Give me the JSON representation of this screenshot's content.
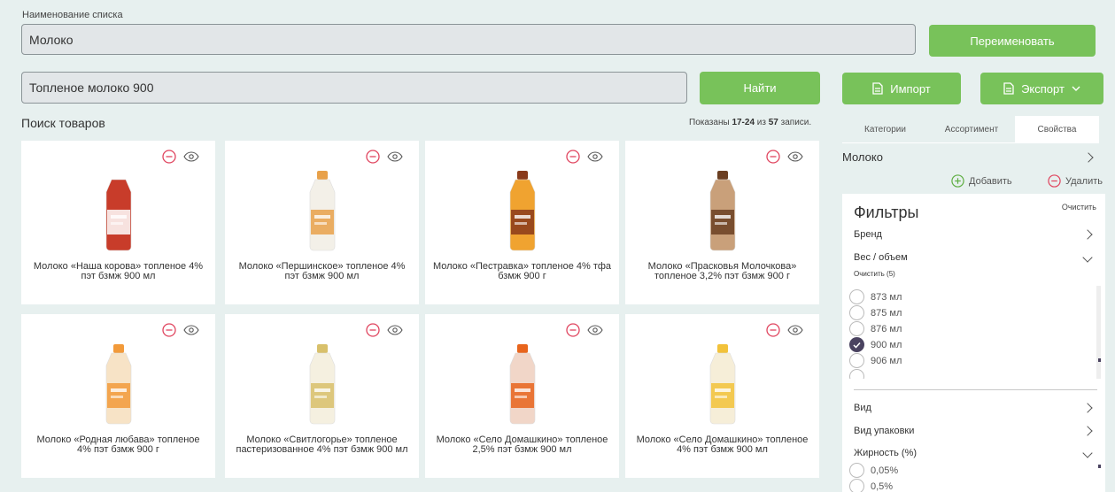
{
  "list_name": {
    "label": "Наименование списка",
    "value": "Молоко",
    "rename_button": "Переименовать"
  },
  "search": {
    "value": "Топленое молоко 900",
    "find_button": "Найти"
  },
  "toolbar": {
    "import_label": "Импорт",
    "export_label": "Экспорт"
  },
  "products": {
    "title": "Поиск товаров",
    "shown_prefix": "Показаны",
    "shown_range": "17-24",
    "shown_of": "из",
    "shown_total": "57",
    "shown_suffix": "записи.",
    "items": [
      {
        "name": "Молоко «Наша корова» топленое 4% пэт бзмж 900 мл"
      },
      {
        "name": "Молоко «Першинское» топленое 4% пэт бзмж 900 мл"
      },
      {
        "name": "Молоко «Пестравка» топленое 4% тфа бзмж 900 г"
      },
      {
        "name": "Молоко «Прасковья Молочкова» топленое 3,2% пэт бзмж 900 г"
      },
      {
        "name": "Молоко «Родная любава» топленое 4% пэт бзмж 900 г"
      },
      {
        "name": "Молоко «Свитлогорье» топленое пастеризованное 4% пэт бзмж 900 мл"
      },
      {
        "name": "Молоко «Село Домашкино» топленое 2,5% пэт бзмж 900 мл"
      },
      {
        "name": "Молоко «Село Домашкино» топленое 4% пэт бзмж 900 мл"
      }
    ]
  },
  "side": {
    "tabs": [
      "Категории",
      "Ассортимент",
      "Свойства"
    ],
    "category": "Молоко",
    "add_label": "Добавить",
    "delete_label": "Удалить"
  },
  "filters": {
    "title": "Фильтры",
    "clear_label": "Очистить",
    "brand": "Бренд",
    "weight": "Вес / объем",
    "weight_clear": "Очистить (5)",
    "weight_options": [
      "873 мл",
      "875 мл",
      "876 мл",
      "900 мл",
      "906 мл"
    ],
    "kind": "Вид",
    "package": "Вид упаковки",
    "fat": "Жирность (%)",
    "fat_options": [
      "0,05%",
      "0,5%"
    ]
  },
  "colors": {
    "accent_green": "#78c25a",
    "remove_red": "#e0455f",
    "background": "#e7f0ef"
  }
}
